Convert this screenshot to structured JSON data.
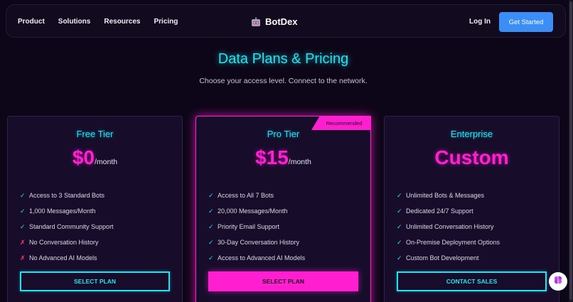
{
  "nav": {
    "links": [
      "Product",
      "Solutions",
      "Resources",
      "Pricing"
    ],
    "brand": "BotDex",
    "login": "Log In",
    "cta": "Get Started"
  },
  "hero": {
    "title": "Data Plans & Pricing",
    "subtitle": "Choose your access level. Connect to the network."
  },
  "plans": [
    {
      "name": "Free Tier",
      "price": "$0",
      "unit": "/month",
      "features": [
        {
          "mark": "✓",
          "text": "Access to 3 Standard Bots"
        },
        {
          "mark": "✓",
          "text": "1,000 Messages/Month"
        },
        {
          "mark": "✓",
          "text": "Standard Community Support"
        },
        {
          "mark": "✗",
          "text": "No Conversation History"
        },
        {
          "mark": "✗",
          "text": "No Advanced AI Models"
        }
      ],
      "button": "SELECT PLAN"
    },
    {
      "name": "Pro Tier",
      "badge": "Recommended",
      "price": "$15",
      "unit": "/month",
      "features": [
        {
          "mark": "✓",
          "text": "Access to All 7 Bots"
        },
        {
          "mark": "✓",
          "text": "20,000 Messages/Month"
        },
        {
          "mark": "✓",
          "text": "Priority Email Support"
        },
        {
          "mark": "✓",
          "text": "30-Day Conversation History"
        },
        {
          "mark": "✓",
          "text": "Access to Advanced AI Models"
        }
      ],
      "button": "SELECT PLAN"
    },
    {
      "name": "Enterprise",
      "price": "Custom",
      "unit": "",
      "features": [
        {
          "mark": "✓",
          "text": "Unlimited Bots & Messages"
        },
        {
          "mark": "✓",
          "text": "Dedicated 24/7 Support"
        },
        {
          "mark": "✓",
          "text": "Unlimited Conversation History"
        },
        {
          "mark": "✓",
          "text": "On-Premise Deployment Options"
        },
        {
          "mark": "✓",
          "text": "Custom Bot Development"
        }
      ],
      "button": "CONTACT SALES"
    }
  ],
  "colors": {
    "background": "#0d0618",
    "cyan_accent": "#22e4f0",
    "magenta_accent": "#ff1fd0",
    "cta_blue": "#3a8ef5",
    "cross_red": "#ff3b6b"
  },
  "icons": {
    "brand": "robot-icon",
    "chat_fab": "brain-icon"
  }
}
